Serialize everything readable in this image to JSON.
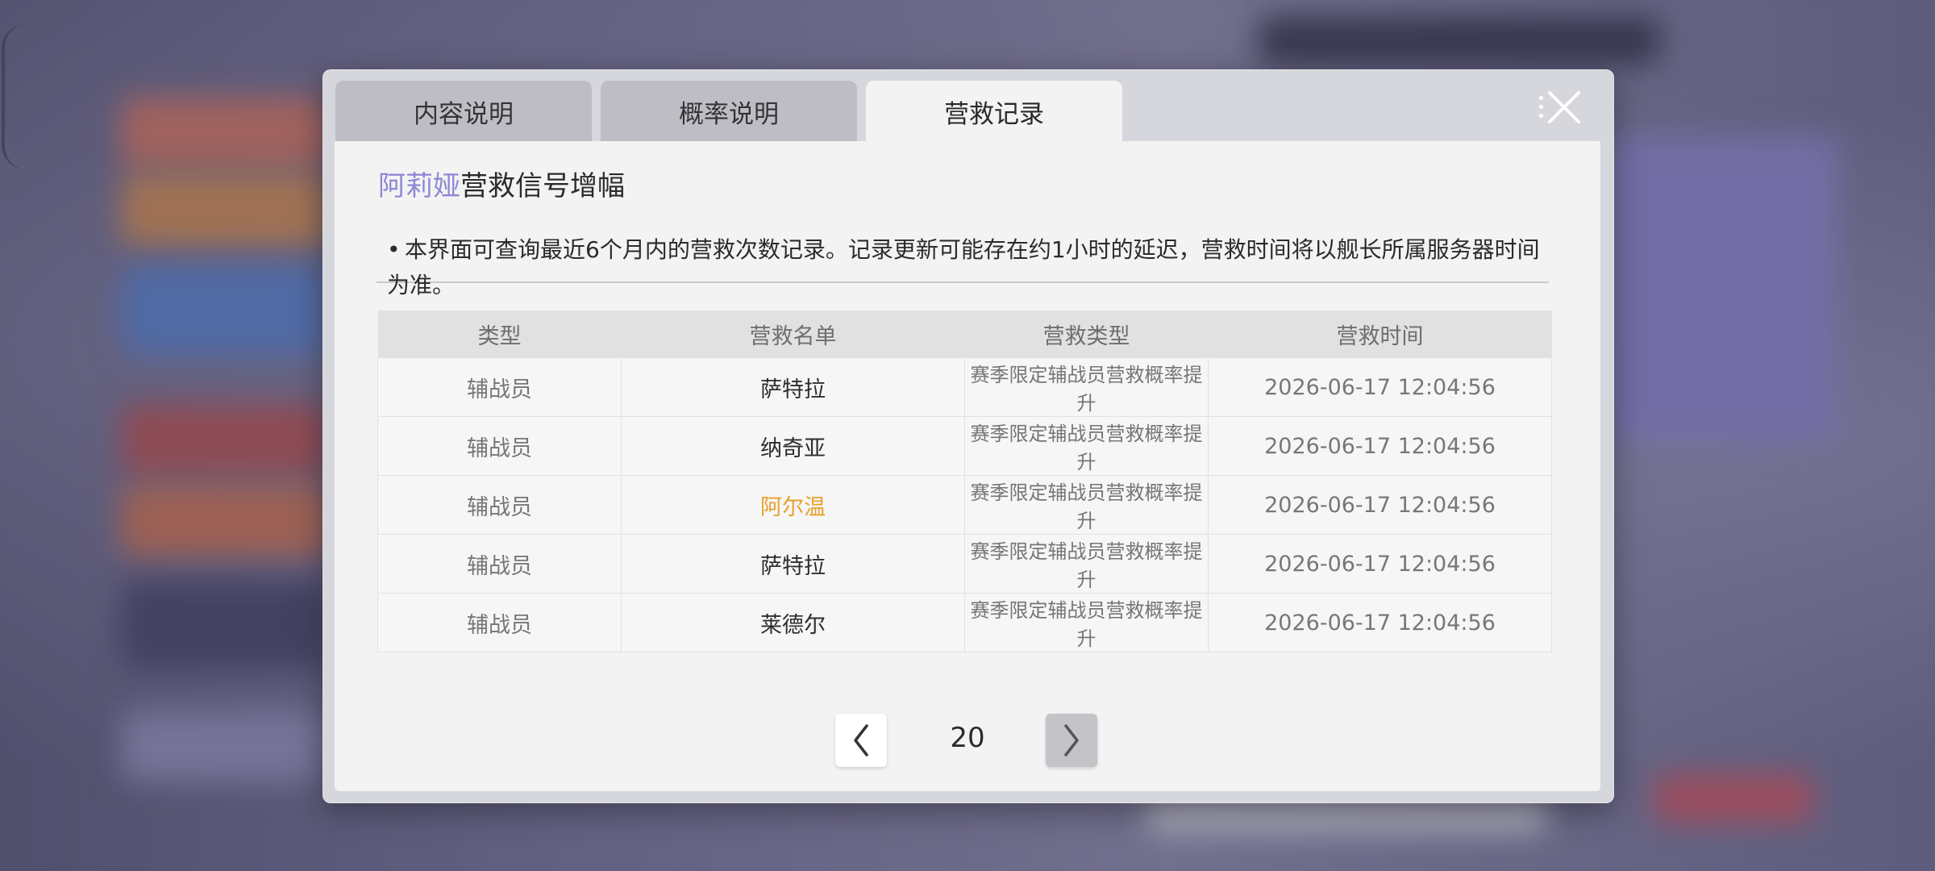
{
  "tabs": [
    {
      "label": "内容说明",
      "active": false
    },
    {
      "label": "概率说明",
      "active": false
    },
    {
      "label": "营救记录",
      "active": true
    }
  ],
  "title": {
    "highlight": "阿莉娅",
    "text": "营救信号增幅"
  },
  "notice": {
    "bullet": "•",
    "text": "本界面可查询最近6个月内的营救次数记录。记录更新可能存在约1小时的延迟，营救时间将以舰长所属服务器时间为准。"
  },
  "table": {
    "headers": [
      "类型",
      "营救名单",
      "营救类型",
      "营救时间"
    ],
    "rows": [
      {
        "type": "辅战员",
        "name": "萨特拉",
        "rescue_type": "赛季限定辅战员营救概率提升",
        "time": "2026-06-17 12:04:56"
      },
      {
        "type": "辅战员",
        "name": "纳奇亚",
        "rescue_type": "赛季限定辅战员营救概率提升",
        "time": "2026-06-17 12:04:56"
      },
      {
        "type": "辅战员",
        "name": "阿尔温",
        "rescue_type": "赛季限定辅战员营救概率提升",
        "time": "2026-06-17 12:04:56"
      },
      {
        "type": "辅战员",
        "name": "萨特拉",
        "rescue_type": "赛季限定辅战员营救概率提升",
        "time": "2026-06-17 12:04:56"
      },
      {
        "type": "辅战员",
        "name": "莱德尔",
        "rescue_type": "赛季限定辅战员营救概率提升",
        "time": "2026-06-17 12:04:56"
      }
    ]
  },
  "pagination": {
    "page": "20"
  },
  "colors": {
    "title_highlight": "#8d87d6",
    "rare_name": "#e8a12c"
  },
  "icons": {
    "close": "close-x-icon",
    "prev": "chevron-left-icon",
    "next": "chevron-right-icon"
  }
}
